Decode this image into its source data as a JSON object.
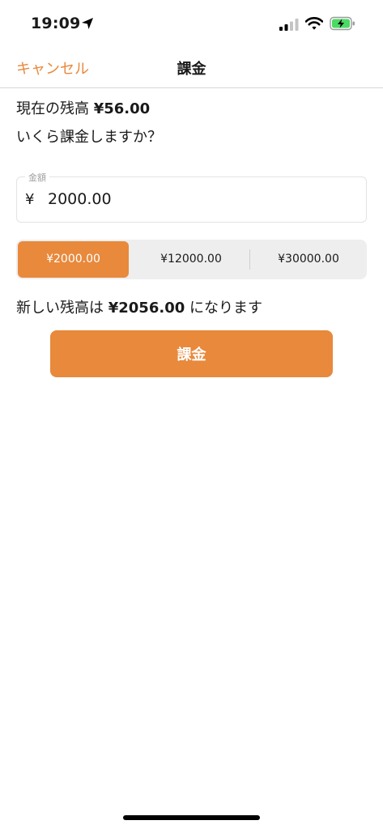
{
  "status_bar": {
    "time": "19:09",
    "icons": [
      "location-arrow-icon",
      "cellular-signal-icon",
      "wifi-icon",
      "battery-charging-icon"
    ]
  },
  "nav": {
    "cancel_label": "キャンセル",
    "title": "課金"
  },
  "balance": {
    "prefix": "現在の残高 ",
    "amount": "¥56.00"
  },
  "question": "いくら課金しますか？",
  "amount_field": {
    "label": "金額",
    "currency": "¥",
    "value": "2000.00"
  },
  "presets": {
    "options": [
      "¥2000.00",
      "¥12000.00",
      "¥30000.00"
    ],
    "selected": "¥2000.00"
  },
  "new_balance": {
    "prefix": "新しい残高は ",
    "amount": "¥2056.00",
    "suffix": " になります"
  },
  "charge_button_label": "課金",
  "colors": {
    "accent": "#e8893c",
    "text": "#1a1a1a",
    "segment_bg": "#eeeeee",
    "battery_green": "#4cd964"
  }
}
